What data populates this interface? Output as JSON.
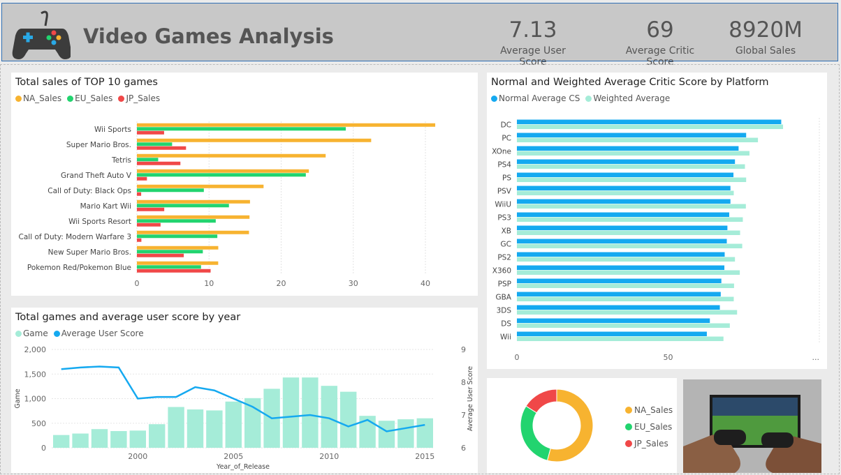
{
  "header": {
    "title": "Video Games Analysis",
    "kpis": [
      {
        "value": "7.13",
        "label": "Average User Score"
      },
      {
        "value": "69",
        "label": "Average Critic Score"
      },
      {
        "value": "8920M",
        "label": "Global Sales"
      }
    ]
  },
  "colors": {
    "na": "#f7b330",
    "eu": "#22d46f",
    "jp": "#f04848",
    "blue": "#15a9f0",
    "mint": "#a5ecd8"
  },
  "chart_data": [
    {
      "type": "bar",
      "title": "Total sales of TOP 10 games",
      "categories": [
        "Wii Sports",
        "Super Mario Bros.",
        "Tetris",
        "Grand Theft Auto V",
        "Call of Duty: Black Ops",
        "Mario Kart Wii",
        "Wii Sports Resort",
        "Call of Duty: Modern Warfare 3",
        "New Super Mario Bros.",
        "Pokemon Red/Pokemon Blue"
      ],
      "series": [
        {
          "name": "NA_Sales",
          "values": [
            41.36,
            32.48,
            26.17,
            23.84,
            17.56,
            15.68,
            15.61,
            15.54,
            11.28,
            11.27
          ]
        },
        {
          "name": "EU_Sales",
          "values": [
            28.96,
            4.88,
            2.95,
            23.42,
            9.28,
            12.76,
            10.93,
            11.15,
            9.14,
            8.89
          ]
        },
        {
          "name": "JP_Sales",
          "values": [
            3.77,
            6.81,
            6.03,
            1.39,
            0.59,
            3.79,
            3.28,
            0.62,
            6.5,
            10.22
          ]
        }
      ],
      "xticks": [
        "0",
        "10",
        "20",
        "30",
        "40"
      ],
      "xlim": [
        0,
        43
      ]
    },
    {
      "type": "bar",
      "title": "Normal and Weighted Average Critic Score by Platform",
      "categories": [
        "DC",
        "PC",
        "XOne",
        "PS4",
        "PS",
        "PSV",
        "WiiU",
        "PS3",
        "XB",
        "GC",
        "PS2",
        "X360",
        "PSP",
        "GBA",
        "3DS",
        "DS",
        "Wii"
      ],
      "series": [
        {
          "name": "Normal Average CS",
          "values": [
            87.4,
            75.8,
            73.3,
            72.1,
            71.6,
            70.6,
            70.6,
            70.2,
            69.6,
            69.4,
            68.7,
            68.6,
            67.6,
            67.4,
            67.1,
            63.8,
            62.8
          ]
        },
        {
          "name": "Weighted Average",
          "values": [
            88.0,
            79.7,
            76.9,
            75.4,
            75.8,
            71.7,
            75.7,
            74.7,
            73.8,
            74.5,
            72.1,
            73.7,
            71.8,
            71.7,
            72.8,
            70.4,
            68.3
          ]
        }
      ],
      "xticks": [
        "0",
        "50",
        "..."
      ],
      "xlim": [
        0,
        100
      ]
    },
    {
      "type": "bar",
      "title": "Total games and average user score by year",
      "x": [
        1996,
        1997,
        1998,
        1999,
        2000,
        2001,
        2002,
        2003,
        2004,
        2005,
        2006,
        2007,
        2008,
        2009,
        2010,
        2011,
        2012,
        2013,
        2014,
        2015
      ],
      "series": [
        {
          "name": "Game",
          "values": [
            260,
            290,
            380,
            340,
            350,
            480,
            830,
            780,
            760,
            940,
            1010,
            1200,
            1430,
            1430,
            1260,
            1140,
            650,
            550,
            580,
            600
          ]
        },
        {
          "name": "Average User Score",
          "values": [
            8.4,
            8.45,
            8.48,
            8.45,
            7.5,
            7.55,
            7.55,
            7.85,
            7.75,
            7.5,
            7.25,
            6.9,
            6.95,
            7.0,
            6.9,
            6.65,
            6.85,
            6.5,
            6.6,
            6.7
          ]
        }
      ],
      "xlabel": "Year_of_Release",
      "ylabel": "Game",
      "y2label": "Average User Score",
      "yticks": [
        "0",
        "500",
        "1,000",
        "1,500",
        "2,000"
      ],
      "y2ticks": [
        "6",
        "7",
        "8",
        "9"
      ],
      "xticks": [
        "2000",
        "2005",
        "2010",
        "2015"
      ],
      "ylim": [
        0,
        2000
      ],
      "y2lim": [
        6,
        9
      ]
    },
    {
      "type": "pie",
      "title": "",
      "categories": [
        "NA_Sales",
        "EU_Sales",
        "JP_Sales"
      ],
      "values": [
        4400,
        2420,
        1300
      ]
    }
  ]
}
